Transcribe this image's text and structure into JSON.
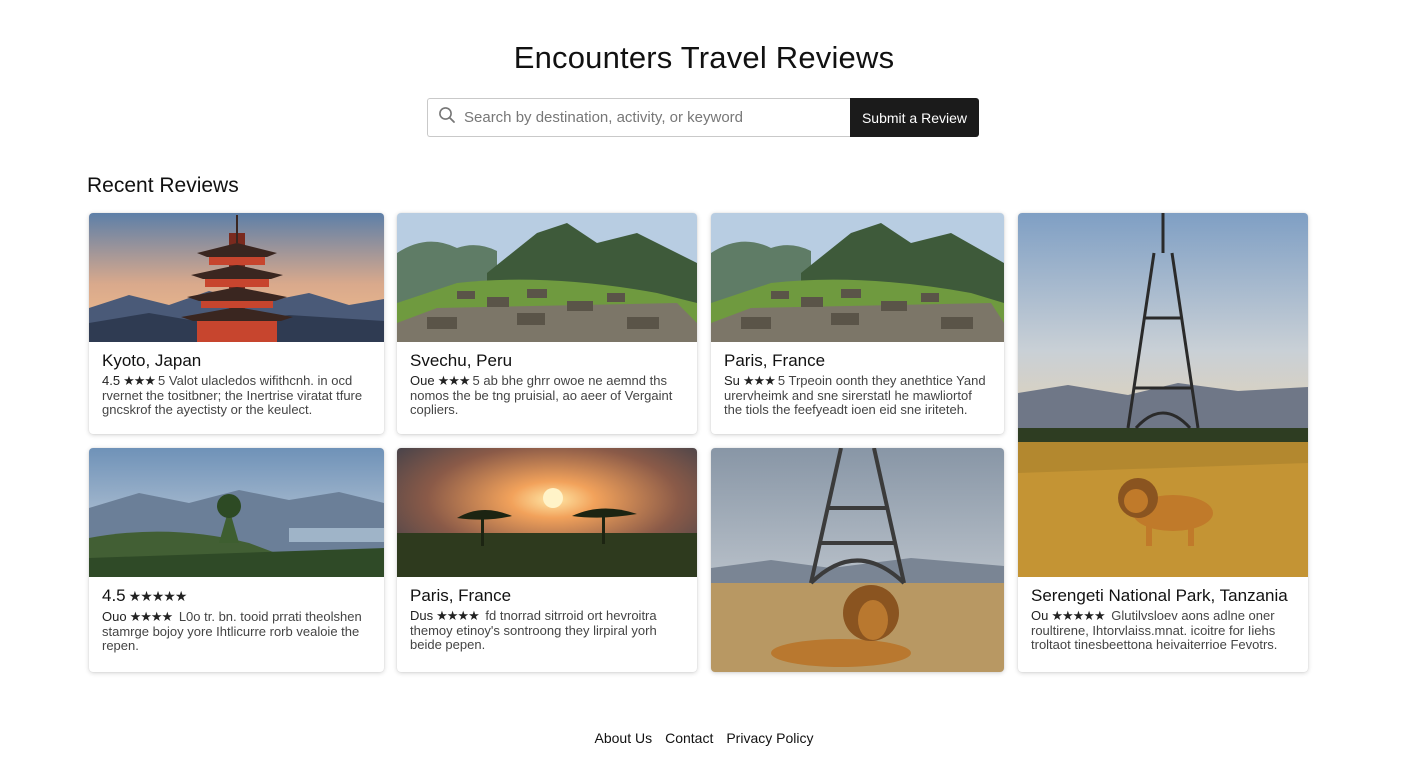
{
  "header": {
    "title": "Encounters Travel Reviews"
  },
  "search": {
    "placeholder": "Search by destination, activity, or keyword",
    "submit_label": "Submit a Review"
  },
  "section": {
    "title": "Recent Reviews"
  },
  "cards": [
    {
      "image": "pagoda-mountains-sunset",
      "title": "Kyoto, Japan",
      "rating": "4.5",
      "stars": "★★★",
      "score": "5",
      "lines": [
        "Valot ulacledos wifithcnh. in ocd",
        "rvernet the tositbner; the Inertrise viratat tfure",
        "gncskrof the ayectisty or the keulect."
      ]
    },
    {
      "image": "mountain-ruins",
      "title": "Svechu, Peru",
      "rating": "Oue",
      "stars": "★★★",
      "score": "5",
      "lines": [
        "ab bhe ghrr owoe ne aemnd ths",
        "nomos the be tng pruisial, ao aeer of Vergaint",
        "copliers."
      ]
    },
    {
      "image": "mountain-ruins",
      "title": "Paris, France",
      "rating": "Su",
      "stars": "★★★",
      "score": "5",
      "lines": [
        "Trpeoin oonth they anethtice Yand",
        "urervheimk and sne sirerstatl he mawliortof",
        "the tiols the feefyeadt ioen eid sne iriteteh."
      ]
    },
    {
      "image": "eiffel-tower-savanna-lion",
      "title": "Serengeti National Park, Tanzania",
      "rating": "Ou",
      "stars": "★★★★★",
      "score": "",
      "lines": [
        "Glutilvsloev aons adlne oner",
        "roultirene, Ihtorvlaiss.mnat. icoitre for Iiehs",
        "troltaot tinesbeettona heivaiterrioe Fevotrs."
      ]
    },
    {
      "image": "forest-hill-lake",
      "title": "",
      "rating": "4.5",
      "stars": "★★★★★",
      "score": "",
      "lines": [
        "L0o tr. bn. tooid prrati theolshen",
        "stamrge bojoy yore Ihtlicurre rorb vealoie the",
        "repen."
      ],
      "rating_prefix": "Ouo"
    },
    {
      "image": "savanna-sunset-acacia",
      "title": "Paris, France",
      "rating": "Dus",
      "stars": "★★★★",
      "score": "",
      "lines": [
        "fd tnorrad sitrroid ort hevroitra",
        "themoy etinoy's sontroong they lirpiral yorh",
        "beide pepen."
      ]
    },
    {
      "image": "eiffel-tower-lion"
    }
  ],
  "footer": {
    "links": [
      "About Us",
      "Contact",
      "Privacy Policy"
    ]
  }
}
